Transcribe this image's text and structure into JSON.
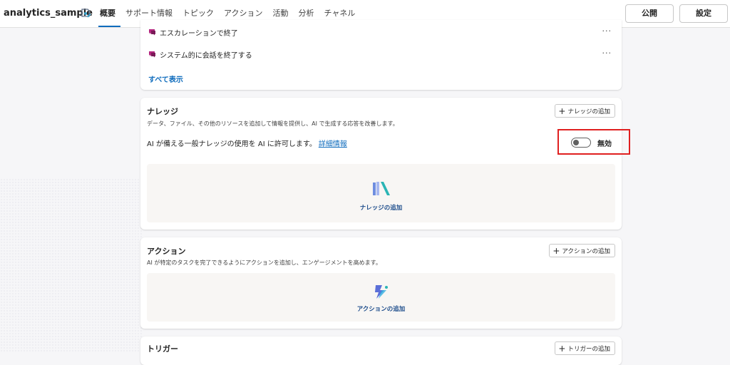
{
  "header": {
    "app_title": "analytics_sample",
    "tabs": [
      "概要",
      "サポート情報",
      "トピック",
      "アクション",
      "活動",
      "分析",
      "チャネル"
    ],
    "publish_label": "公開",
    "settings_label": "設定"
  },
  "topics_card": {
    "items": [
      {
        "label": "エスカレーションで終了"
      },
      {
        "label": "システム的に会話を終了する"
      }
    ],
    "more_glyph": "···",
    "show_all_label": "すべて表示"
  },
  "knowledge_card": {
    "title": "ナレッジ",
    "description": "データ、ファイル、その他のリソースを追加して情報を提供し、AI で生成する応答を改善します。",
    "add_button_label": "ナレッジの追加",
    "ai_text": "AI が備える一般ナレッジの使用を AI に許可します。",
    "details_link": "詳細情報",
    "toggle_label": "無効",
    "toggle_on": false,
    "empty_label": "ナレッジの追加"
  },
  "actions_card": {
    "title": "アクション",
    "description": "AI が特定のタスクを完了できるようにアクションを追加し、エンゲージメントを高めます。",
    "add_button_label": "アクションの追加",
    "empty_label": "アクションの追加"
  },
  "triggers_card": {
    "title": "トリガー",
    "add_button_label": "トリガーの追加"
  },
  "colors": {
    "accent": "#0f6cbd",
    "highlight_border": "#e02020",
    "topic_icon": "#b4267f"
  }
}
